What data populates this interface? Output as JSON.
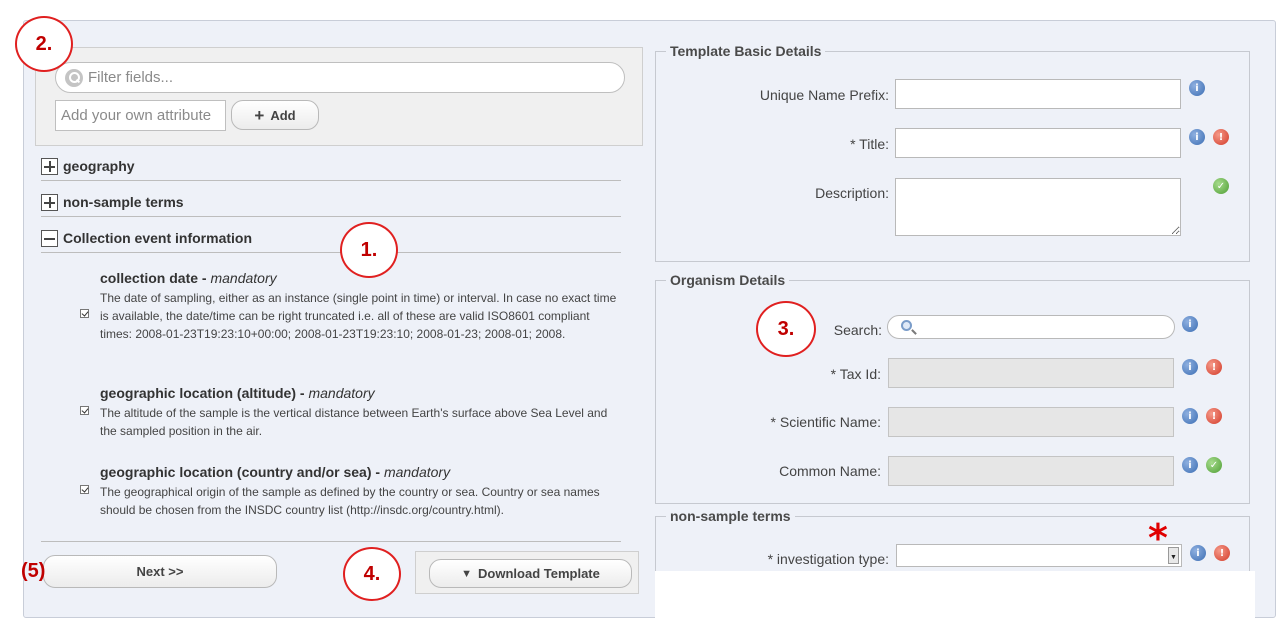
{
  "filter": {
    "search_placeholder": "Filter fields...",
    "attribute_placeholder": "Add your own attribute",
    "add_label": "Add"
  },
  "sections": [
    {
      "label": "geography",
      "expanded": false
    },
    {
      "label": "non-sample terms",
      "expanded": false
    },
    {
      "label": "Collection event information",
      "expanded": true
    }
  ],
  "fields": [
    {
      "title": "collection date",
      "mandatory": "mandatory",
      "description": "The date of sampling, either as an instance (single point in time) or interval. In case no exact time is available, the date/time can be right truncated i.e. all of these are valid ISO8601 compliant times: 2008-01-23T19:23:10+00:00; 2008-01-23T19:23:10; 2008-01-23; 2008-01; 2008."
    },
    {
      "title": "geographic location (altitude)",
      "mandatory": "mandatory",
      "description": "The altitude of the sample is the vertical distance between Earth's surface above Sea Level and the sampled position in the air."
    },
    {
      "title": "geographic location (country and/or sea)",
      "mandatory": "mandatory",
      "description": "The geographical origin of the sample as defined by the country or sea. Country or sea names should be chosen from the INSDC country list (http://insdc.org/country.html)."
    }
  ],
  "buttons": {
    "next": "Next >>",
    "download": "Download Template"
  },
  "template_basic": {
    "legend": "Template Basic Details",
    "prefix_label": "Unique Name Prefix:",
    "title_label": "* Title:",
    "description_label": "Description:"
  },
  "organism": {
    "legend": "Organism Details",
    "search_label": "Search:",
    "taxid_label": "* Tax Id:",
    "sciname_label": "* Scientific Name:",
    "common_label": "Common Name:"
  },
  "nonsample": {
    "legend": "non-sample terms",
    "investigation_label": "* investigation type:"
  },
  "annotations": {
    "c1": "1.",
    "c2": "2.",
    "c3": "3.",
    "c4": "4.",
    "c5": "(5)",
    "star": "*"
  },
  "icons": {
    "info": "info-icon",
    "error": "error-icon",
    "ok": "check-icon",
    "info_glyph": "i",
    "error_glyph": "!",
    "ok_glyph": "✓"
  },
  "colors": {
    "annotation_red": "#e02020",
    "panel_bg": "#eef1f8",
    "info_blue": "#3b6db3",
    "error_red": "#d33a28",
    "ok_green": "#4e9e34"
  }
}
